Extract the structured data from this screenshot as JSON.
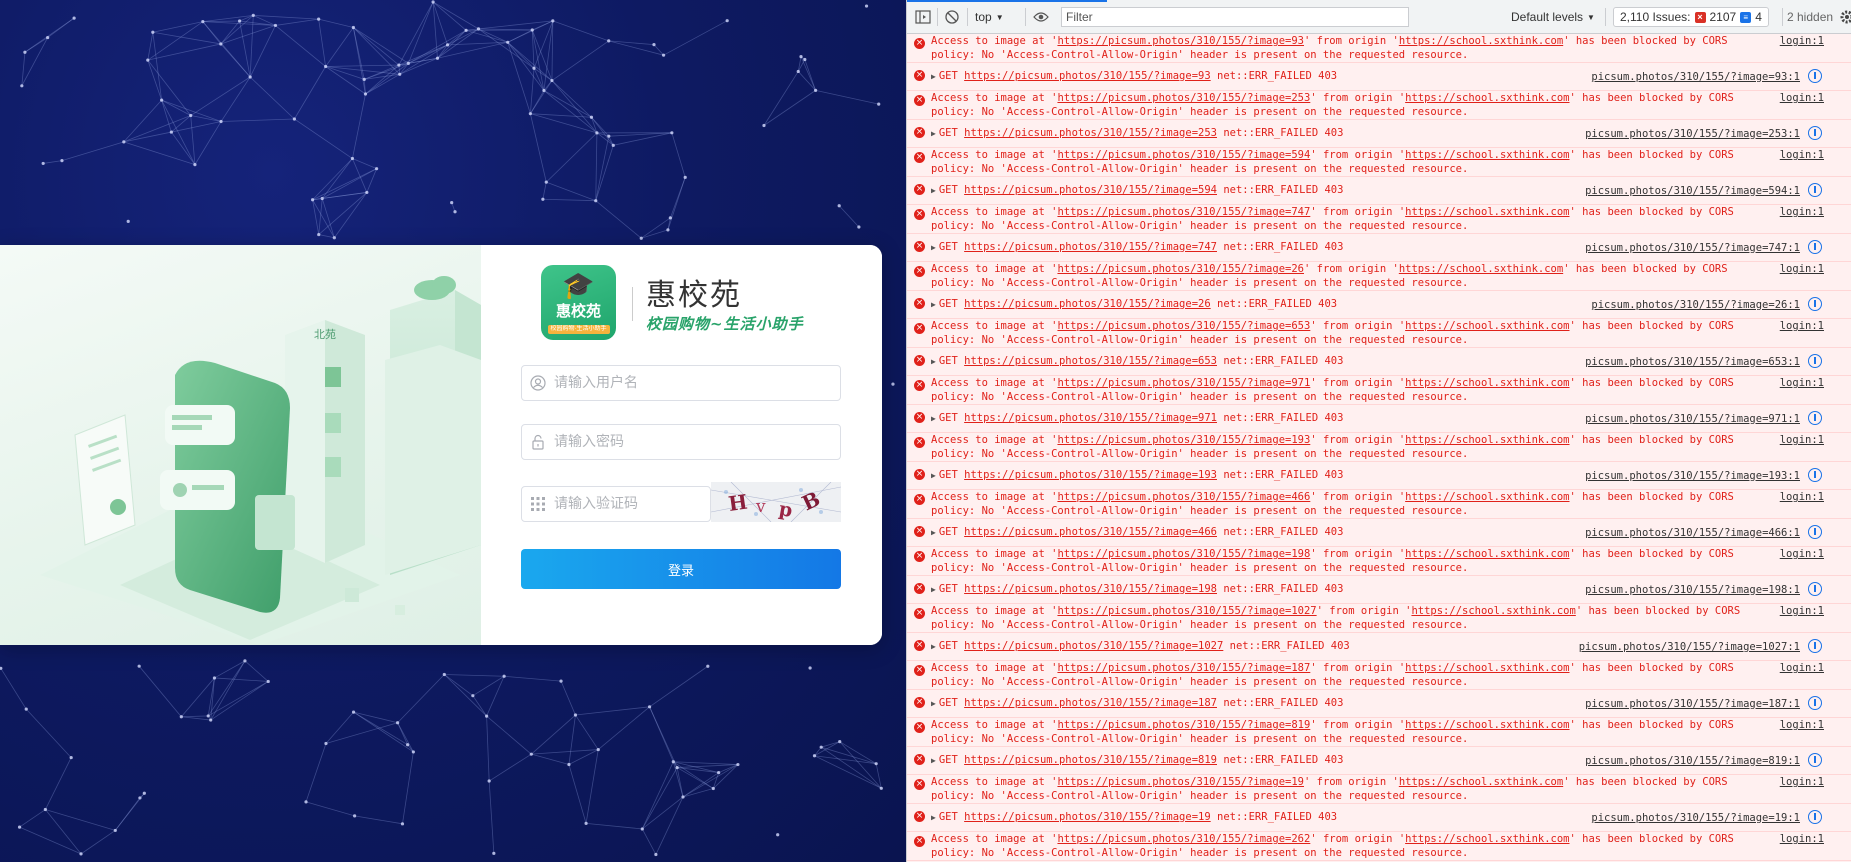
{
  "brand": {
    "logo_text": "惠校苑",
    "logo_strip": "校园购物·生活小助手",
    "title": "惠校苑",
    "slogan": "校园购物~生活小助手",
    "illustration_sign": "北苑"
  },
  "login": {
    "username_placeholder": "请输入用户名",
    "password_placeholder": "请输入密码",
    "captcha_placeholder": "请输入验证码",
    "captcha_text": "HvpB",
    "submit_label": "登录"
  },
  "devtools": {
    "context": "top",
    "filter_placeholder": "Filter",
    "levels": "Default levels",
    "issues_label": "2,110 Issues:",
    "issues_errors": "2107",
    "issues_info": "4",
    "hidden": "2 hidden",
    "colors": {
      "error_text": "#e0211a",
      "error_bg": "#fff0f0",
      "link_blue": "#1a73e8"
    },
    "rows": [
      {
        "image": "93"
      },
      {
        "image": "253"
      },
      {
        "image": "594"
      },
      {
        "image": "747"
      },
      {
        "image": "26"
      },
      {
        "image": "653"
      },
      {
        "image": "971"
      },
      {
        "image": "193"
      },
      {
        "image": "466"
      },
      {
        "image": "198"
      },
      {
        "image": "1027"
      },
      {
        "image": "187"
      },
      {
        "image": "819"
      },
      {
        "image": "19"
      },
      {
        "image": "262"
      }
    ],
    "url_prefix": "https://picsum.photos/310/155/?image=",
    "origin": "https://school.sxthink.com",
    "cors_source": "login:1",
    "cors_tail": "policy: No 'Access-Control-Allow-Origin' header is present on the requested resource.",
    "get_suffix": "net::ERR_FAILED 403",
    "get_source_prefix": "picsum.photos/310/155/?image="
  }
}
